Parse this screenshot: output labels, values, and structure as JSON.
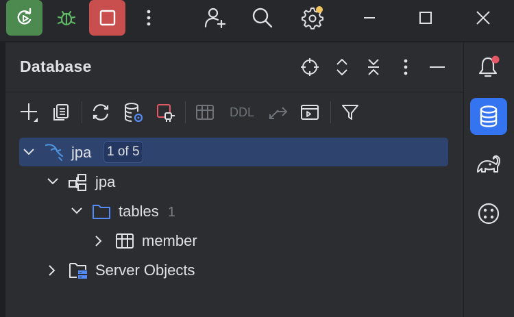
{
  "titlebar": {
    "icons": [
      "run-icon",
      "debug-icon",
      "stop-icon",
      "more-vertical-icon",
      "add-user-icon",
      "search-icon",
      "settings-icon",
      "minimize-icon",
      "maximize-icon",
      "close-icon"
    ]
  },
  "panel": {
    "title": "Database",
    "header_icons": [
      "locate-icon",
      "expand-all-icon",
      "collapse-all-icon",
      "more-vertical-icon",
      "hide-icon"
    ]
  },
  "toolbar": {
    "ddl_label": "DDL",
    "icons": [
      "add-icon",
      "copy-icon",
      "refresh-icon",
      "data-source-properties-icon",
      "disconnect-icon",
      "table-view-icon",
      "ddl-icon",
      "jump-icon",
      "console-icon",
      "filter-icon"
    ]
  },
  "tree": {
    "root": {
      "label": "jpa",
      "badge": "1 of 5",
      "expanded": true,
      "selected": true
    },
    "schema": {
      "label": "jpa",
      "expanded": true
    },
    "tables": {
      "label": "tables",
      "count": "1",
      "expanded": true
    },
    "member": {
      "label": "member",
      "expanded": false
    },
    "server_objects": {
      "label": "Server Objects",
      "expanded": false
    }
  },
  "sidebar": {
    "items": [
      "notifications-icon",
      "database-icon",
      "gradle-icon",
      "more-tools-icon"
    ],
    "active": "database-icon"
  },
  "colors": {
    "accent": "#3574f0",
    "selection": "#2e436e",
    "run_green": "#4d8a4f",
    "stop_red": "#c94f4f",
    "notification_dot": "#e55765",
    "settings_dot": "#f2c55c"
  }
}
